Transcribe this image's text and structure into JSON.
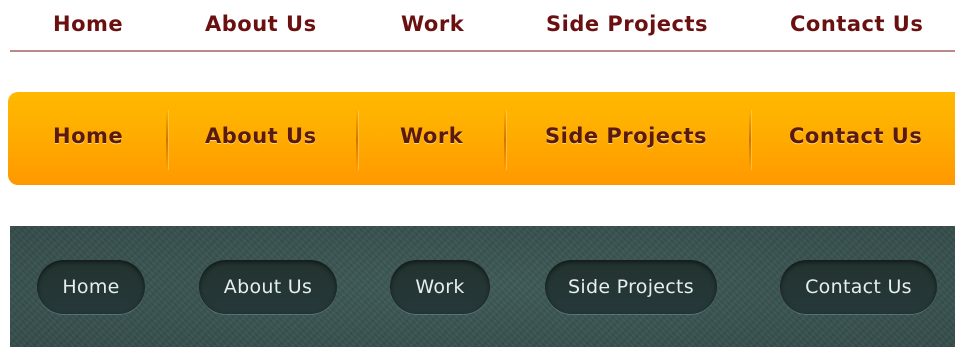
{
  "nav_plain": {
    "items": [
      "Home",
      "About Us",
      "Work",
      "Side Projects",
      "Contact Us"
    ]
  },
  "nav_orange": {
    "items": [
      "Home",
      "About Us",
      "Work",
      "Side Projects",
      "Contact Us"
    ]
  },
  "nav_dark": {
    "items": [
      "Home",
      "About Us",
      "Work",
      "Side Projects",
      "Contact Us"
    ]
  },
  "colors": {
    "plain_text": "#6b1010",
    "plain_underline": "#b98a8a",
    "orange_top": "#ffb800",
    "orange_bottom": "#ff9800",
    "orange_text": "#5a1a10",
    "dark_background": "#3a5452",
    "dark_pill": "#22332f",
    "dark_pill_text": "#e6eeee"
  }
}
